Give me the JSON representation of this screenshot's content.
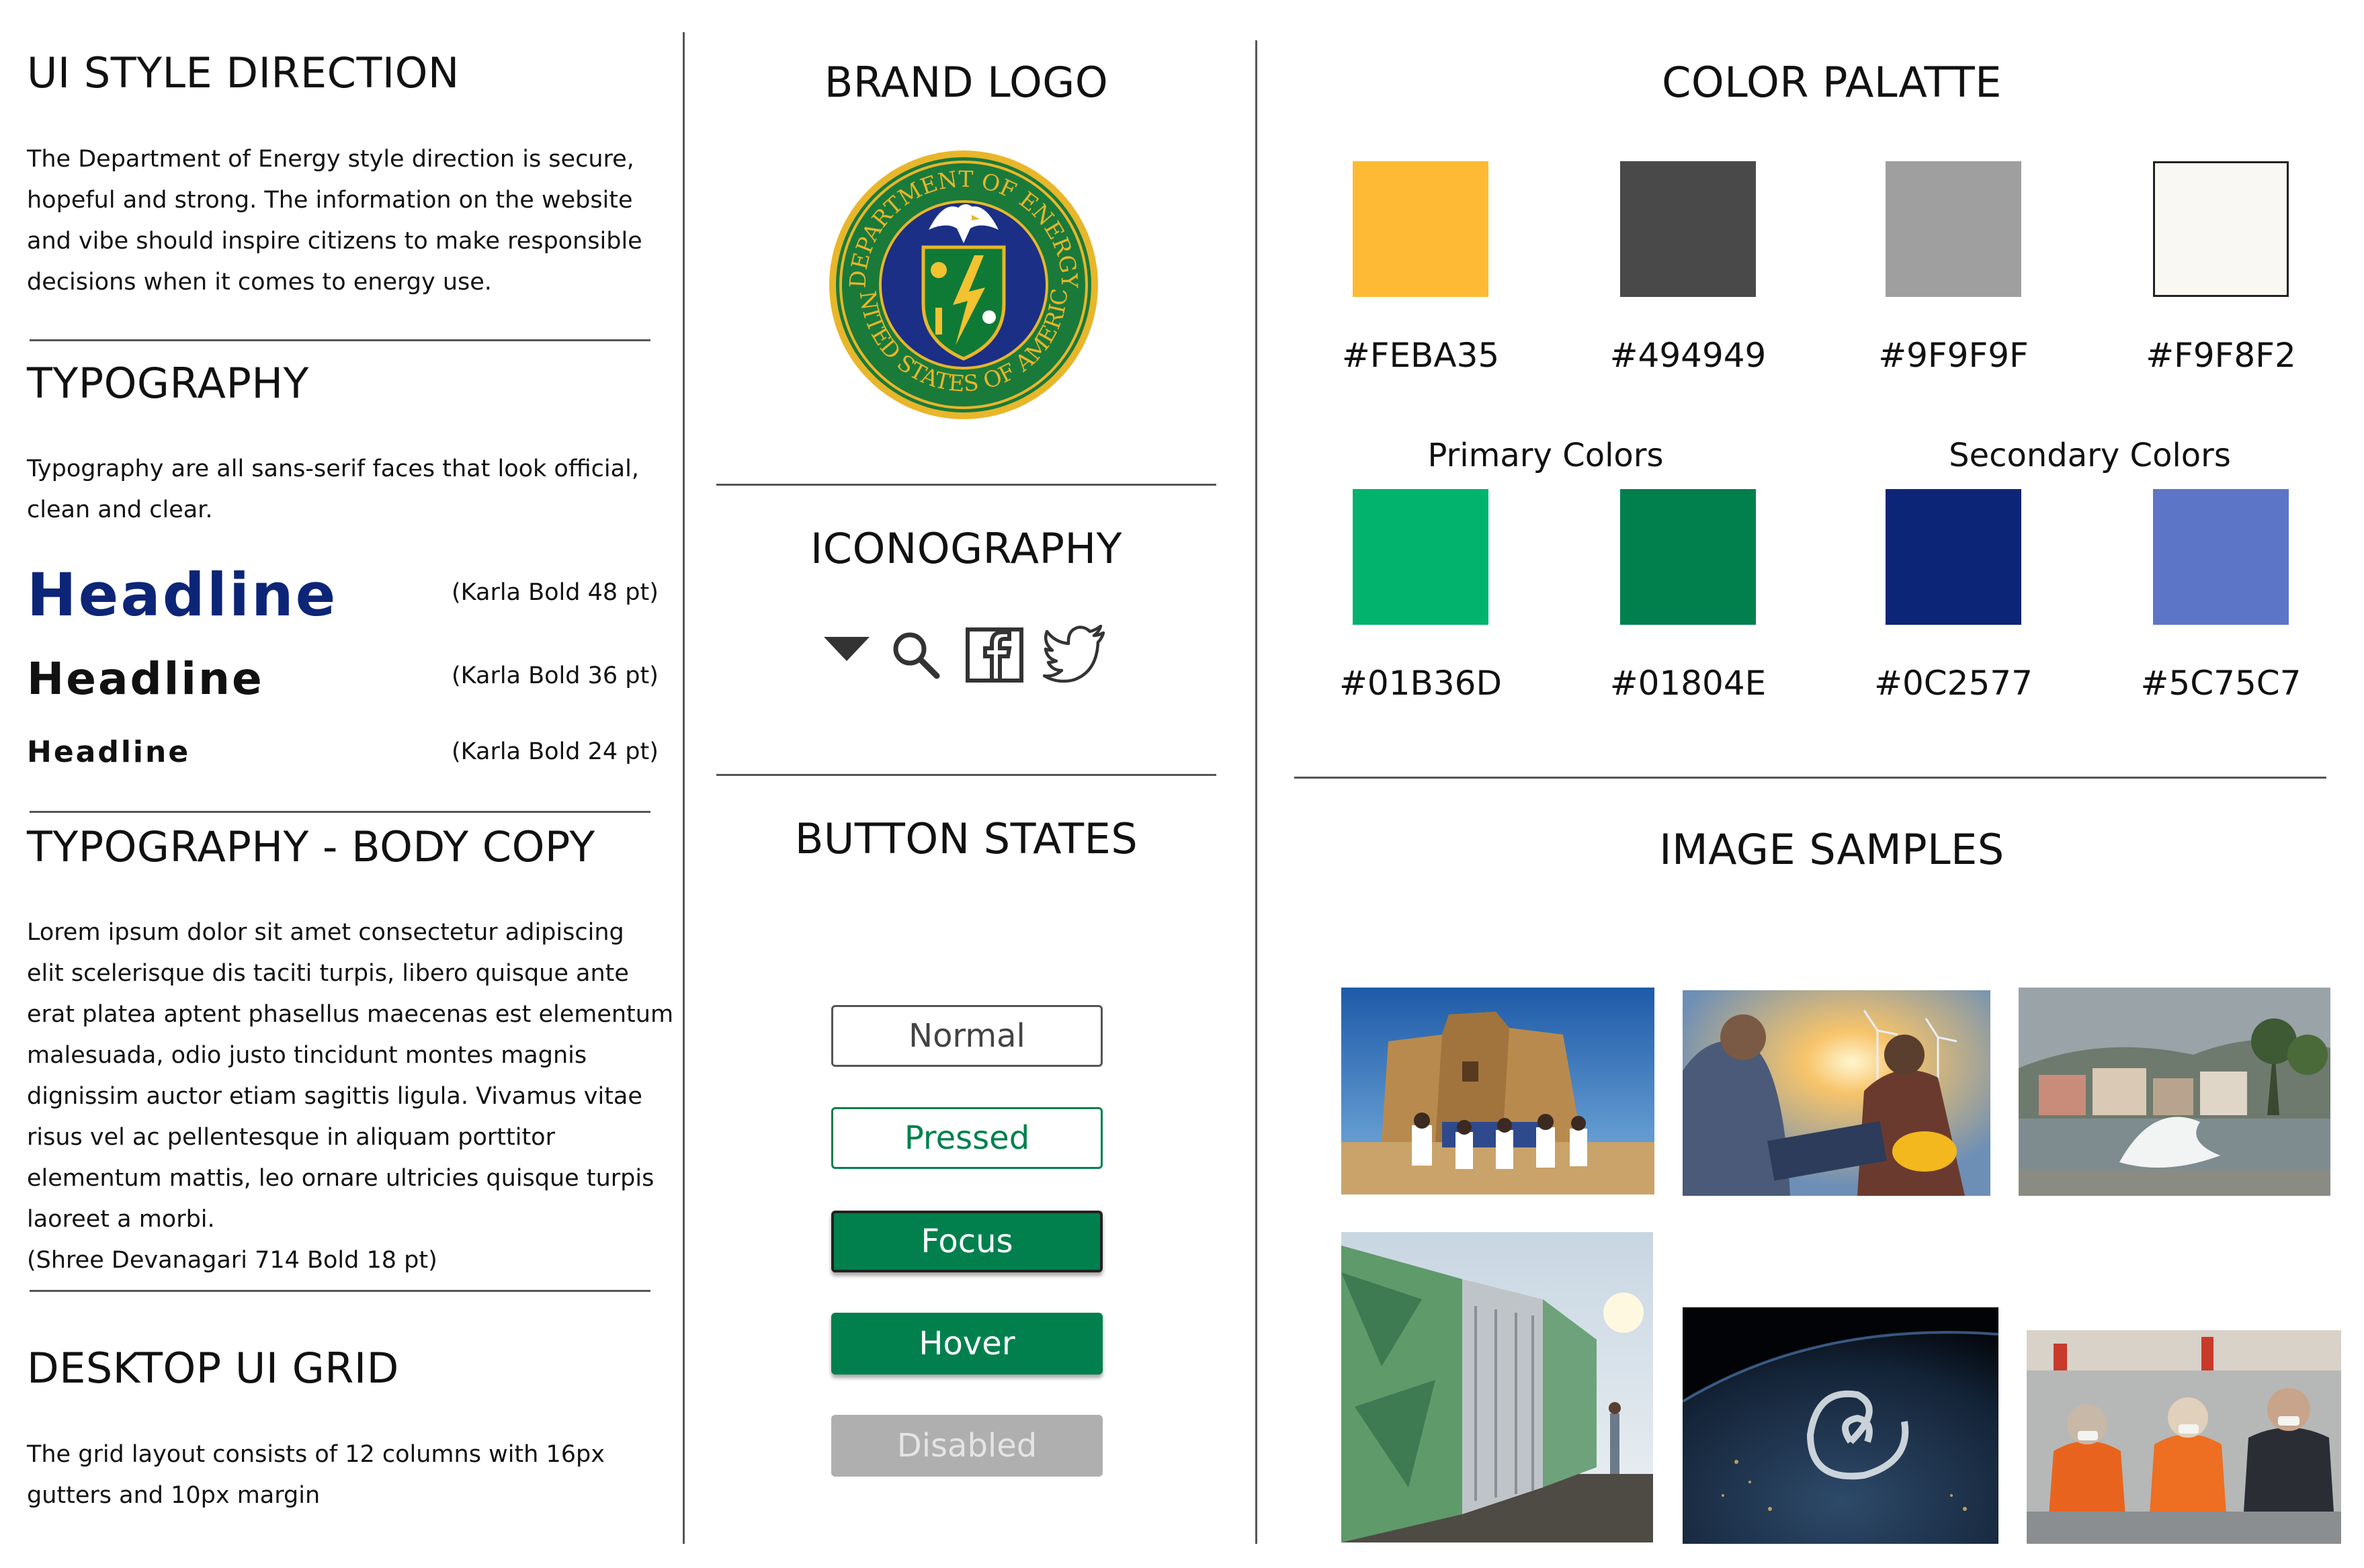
{
  "style_direction": {
    "title": "UI STYLE DIRECTION",
    "lines": [
      "The Department of Energy style direction is secure,",
      "hopeful and strong. The information on the website",
      "and vibe should inspire citizens to make responsible",
      "decisions when it comes to energy use."
    ]
  },
  "typography": {
    "title": "TYPOGRAPHY",
    "lines": [
      "Typography are all sans-serif faces that look official,",
      "clean and clear."
    ],
    "samples": [
      {
        "text": "Headline",
        "note": "(Karla Bold 48 pt)",
        "color": "#0C2577"
      },
      {
        "text": "Headline",
        "note": "(Karla Bold 36 pt)",
        "color": "#111111"
      },
      {
        "text": "Headline",
        "note": "(Karla Bold 24 pt)",
        "color": "#111111"
      }
    ]
  },
  "body_copy": {
    "title": "TYPOGRAPHY - BODY COPY",
    "lines": [
      "Lorem ipsum dolor sit amet consectetur adipiscing",
      "elit scelerisque dis taciti turpis, libero quisque ante",
      "erat platea aptent phasellus maecenas est elementum",
      "malesuada, odio justo tincidunt montes magnis",
      "dignissim auctor etiam sagittis ligula. Vivamus vitae",
      "risus vel ac pellentesque in aliquam porttitor",
      "elementum mattis, leo ornare ultricies quisque turpis",
      "laoreet a morbi.",
      "(Shree Devanagari 714 Bold 18 pt)"
    ]
  },
  "grid": {
    "title": "DESKTOP UI GRID",
    "lines": [
      "The grid layout consists of 12 columns with 16px",
      "gutters and 10px margin"
    ]
  },
  "brand_logo": {
    "title": "BRAND LOGO",
    "seal_text_top": "DEPARTMENT OF ENERGY",
    "seal_text_bottom": "UNITED STATES OF AMERICA"
  },
  "iconography": {
    "title": "ICONOGRAPHY",
    "icons": [
      "caret-down-icon",
      "search-icon",
      "facebook-icon",
      "twitter-icon"
    ]
  },
  "buttons": {
    "title": "BUTTON STATES",
    "normal": "Normal",
    "pressed": "Pressed",
    "focus": "Focus",
    "hover": "Hover",
    "disabled": "Disabled"
  },
  "palette": {
    "title": "COLOR PALATTE",
    "neutrals": [
      "#FEBA35",
      "#494949",
      "#9F9F9F",
      "#F9F8F2"
    ],
    "primary_label": "Primary Colors",
    "secondary_label": "Secondary Colors",
    "primary": [
      "#01B36D",
      "#01804E"
    ],
    "secondary": [
      "#0C2577",
      "#5C75C7"
    ]
  },
  "images": {
    "title": "IMAGE SAMPLES"
  }
}
